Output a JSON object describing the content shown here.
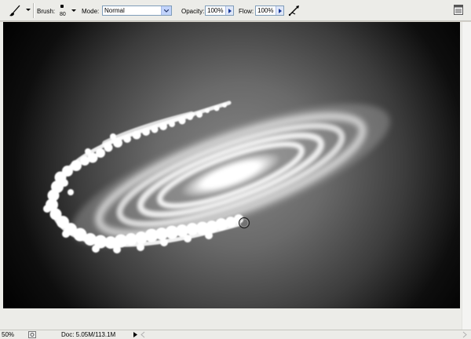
{
  "options_bar": {
    "tool_icon": "brush-tool-icon",
    "brush_label": "Brush:",
    "brush_size": "80",
    "mode_label": "Mode:",
    "mode_value": "Normal",
    "opacity_label": "Opacity:",
    "opacity_value": "100%",
    "flow_label": "Flow:",
    "flow_value": "100%",
    "airbrush_icon": "airbrush-icon",
    "palette_icon": "palette-well-icon"
  },
  "status_bar": {
    "zoom": "50%",
    "doc_info": "Doc: 5.05M/113.1M"
  },
  "colors": {
    "toolbar_bg": "#ecece8",
    "canvas_center": "#878787",
    "canvas_edge": "#000000",
    "field_border": "#7f9db9",
    "dropdown_button": "#c1d3fb"
  }
}
